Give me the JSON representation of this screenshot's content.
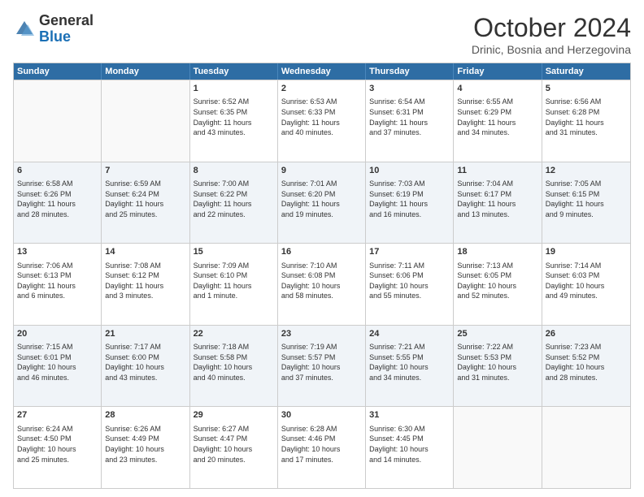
{
  "header": {
    "logo_general": "General",
    "logo_blue": "Blue",
    "month_title": "October 2024",
    "subtitle": "Drinic, Bosnia and Herzegovina"
  },
  "days_of_week": [
    "Sunday",
    "Monday",
    "Tuesday",
    "Wednesday",
    "Thursday",
    "Friday",
    "Saturday"
  ],
  "weeks": [
    {
      "cells": [
        {
          "day": "",
          "lines": []
        },
        {
          "day": "",
          "lines": []
        },
        {
          "day": "1",
          "lines": [
            "Sunrise: 6:52 AM",
            "Sunset: 6:35 PM",
            "Daylight: 11 hours",
            "and 43 minutes."
          ]
        },
        {
          "day": "2",
          "lines": [
            "Sunrise: 6:53 AM",
            "Sunset: 6:33 PM",
            "Daylight: 11 hours",
            "and 40 minutes."
          ]
        },
        {
          "day": "3",
          "lines": [
            "Sunrise: 6:54 AM",
            "Sunset: 6:31 PM",
            "Daylight: 11 hours",
            "and 37 minutes."
          ]
        },
        {
          "day": "4",
          "lines": [
            "Sunrise: 6:55 AM",
            "Sunset: 6:29 PM",
            "Daylight: 11 hours",
            "and 34 minutes."
          ]
        },
        {
          "day": "5",
          "lines": [
            "Sunrise: 6:56 AM",
            "Sunset: 6:28 PM",
            "Daylight: 11 hours",
            "and 31 minutes."
          ]
        }
      ]
    },
    {
      "cells": [
        {
          "day": "6",
          "lines": [
            "Sunrise: 6:58 AM",
            "Sunset: 6:26 PM",
            "Daylight: 11 hours",
            "and 28 minutes."
          ]
        },
        {
          "day": "7",
          "lines": [
            "Sunrise: 6:59 AM",
            "Sunset: 6:24 PM",
            "Daylight: 11 hours",
            "and 25 minutes."
          ]
        },
        {
          "day": "8",
          "lines": [
            "Sunrise: 7:00 AM",
            "Sunset: 6:22 PM",
            "Daylight: 11 hours",
            "and 22 minutes."
          ]
        },
        {
          "day": "9",
          "lines": [
            "Sunrise: 7:01 AM",
            "Sunset: 6:20 PM",
            "Daylight: 11 hours",
            "and 19 minutes."
          ]
        },
        {
          "day": "10",
          "lines": [
            "Sunrise: 7:03 AM",
            "Sunset: 6:19 PM",
            "Daylight: 11 hours",
            "and 16 minutes."
          ]
        },
        {
          "day": "11",
          "lines": [
            "Sunrise: 7:04 AM",
            "Sunset: 6:17 PM",
            "Daylight: 11 hours",
            "and 13 minutes."
          ]
        },
        {
          "day": "12",
          "lines": [
            "Sunrise: 7:05 AM",
            "Sunset: 6:15 PM",
            "Daylight: 11 hours",
            "and 9 minutes."
          ]
        }
      ]
    },
    {
      "cells": [
        {
          "day": "13",
          "lines": [
            "Sunrise: 7:06 AM",
            "Sunset: 6:13 PM",
            "Daylight: 11 hours",
            "and 6 minutes."
          ]
        },
        {
          "day": "14",
          "lines": [
            "Sunrise: 7:08 AM",
            "Sunset: 6:12 PM",
            "Daylight: 11 hours",
            "and 3 minutes."
          ]
        },
        {
          "day": "15",
          "lines": [
            "Sunrise: 7:09 AM",
            "Sunset: 6:10 PM",
            "Daylight: 11 hours",
            "and 1 minute."
          ]
        },
        {
          "day": "16",
          "lines": [
            "Sunrise: 7:10 AM",
            "Sunset: 6:08 PM",
            "Daylight: 10 hours",
            "and 58 minutes."
          ]
        },
        {
          "day": "17",
          "lines": [
            "Sunrise: 7:11 AM",
            "Sunset: 6:06 PM",
            "Daylight: 10 hours",
            "and 55 minutes."
          ]
        },
        {
          "day": "18",
          "lines": [
            "Sunrise: 7:13 AM",
            "Sunset: 6:05 PM",
            "Daylight: 10 hours",
            "and 52 minutes."
          ]
        },
        {
          "day": "19",
          "lines": [
            "Sunrise: 7:14 AM",
            "Sunset: 6:03 PM",
            "Daylight: 10 hours",
            "and 49 minutes."
          ]
        }
      ]
    },
    {
      "cells": [
        {
          "day": "20",
          "lines": [
            "Sunrise: 7:15 AM",
            "Sunset: 6:01 PM",
            "Daylight: 10 hours",
            "and 46 minutes."
          ]
        },
        {
          "day": "21",
          "lines": [
            "Sunrise: 7:17 AM",
            "Sunset: 6:00 PM",
            "Daylight: 10 hours",
            "and 43 minutes."
          ]
        },
        {
          "day": "22",
          "lines": [
            "Sunrise: 7:18 AM",
            "Sunset: 5:58 PM",
            "Daylight: 10 hours",
            "and 40 minutes."
          ]
        },
        {
          "day": "23",
          "lines": [
            "Sunrise: 7:19 AM",
            "Sunset: 5:57 PM",
            "Daylight: 10 hours",
            "and 37 minutes."
          ]
        },
        {
          "day": "24",
          "lines": [
            "Sunrise: 7:21 AM",
            "Sunset: 5:55 PM",
            "Daylight: 10 hours",
            "and 34 minutes."
          ]
        },
        {
          "day": "25",
          "lines": [
            "Sunrise: 7:22 AM",
            "Sunset: 5:53 PM",
            "Daylight: 10 hours",
            "and 31 minutes."
          ]
        },
        {
          "day": "26",
          "lines": [
            "Sunrise: 7:23 AM",
            "Sunset: 5:52 PM",
            "Daylight: 10 hours",
            "and 28 minutes."
          ]
        }
      ]
    },
    {
      "cells": [
        {
          "day": "27",
          "lines": [
            "Sunrise: 6:24 AM",
            "Sunset: 4:50 PM",
            "Daylight: 10 hours",
            "and 25 minutes."
          ]
        },
        {
          "day": "28",
          "lines": [
            "Sunrise: 6:26 AM",
            "Sunset: 4:49 PM",
            "Daylight: 10 hours",
            "and 23 minutes."
          ]
        },
        {
          "day": "29",
          "lines": [
            "Sunrise: 6:27 AM",
            "Sunset: 4:47 PM",
            "Daylight: 10 hours",
            "and 20 minutes."
          ]
        },
        {
          "day": "30",
          "lines": [
            "Sunrise: 6:28 AM",
            "Sunset: 4:46 PM",
            "Daylight: 10 hours",
            "and 17 minutes."
          ]
        },
        {
          "day": "31",
          "lines": [
            "Sunrise: 6:30 AM",
            "Sunset: 4:45 PM",
            "Daylight: 10 hours",
            "and 14 minutes."
          ]
        },
        {
          "day": "",
          "lines": []
        },
        {
          "day": "",
          "lines": []
        }
      ]
    }
  ]
}
